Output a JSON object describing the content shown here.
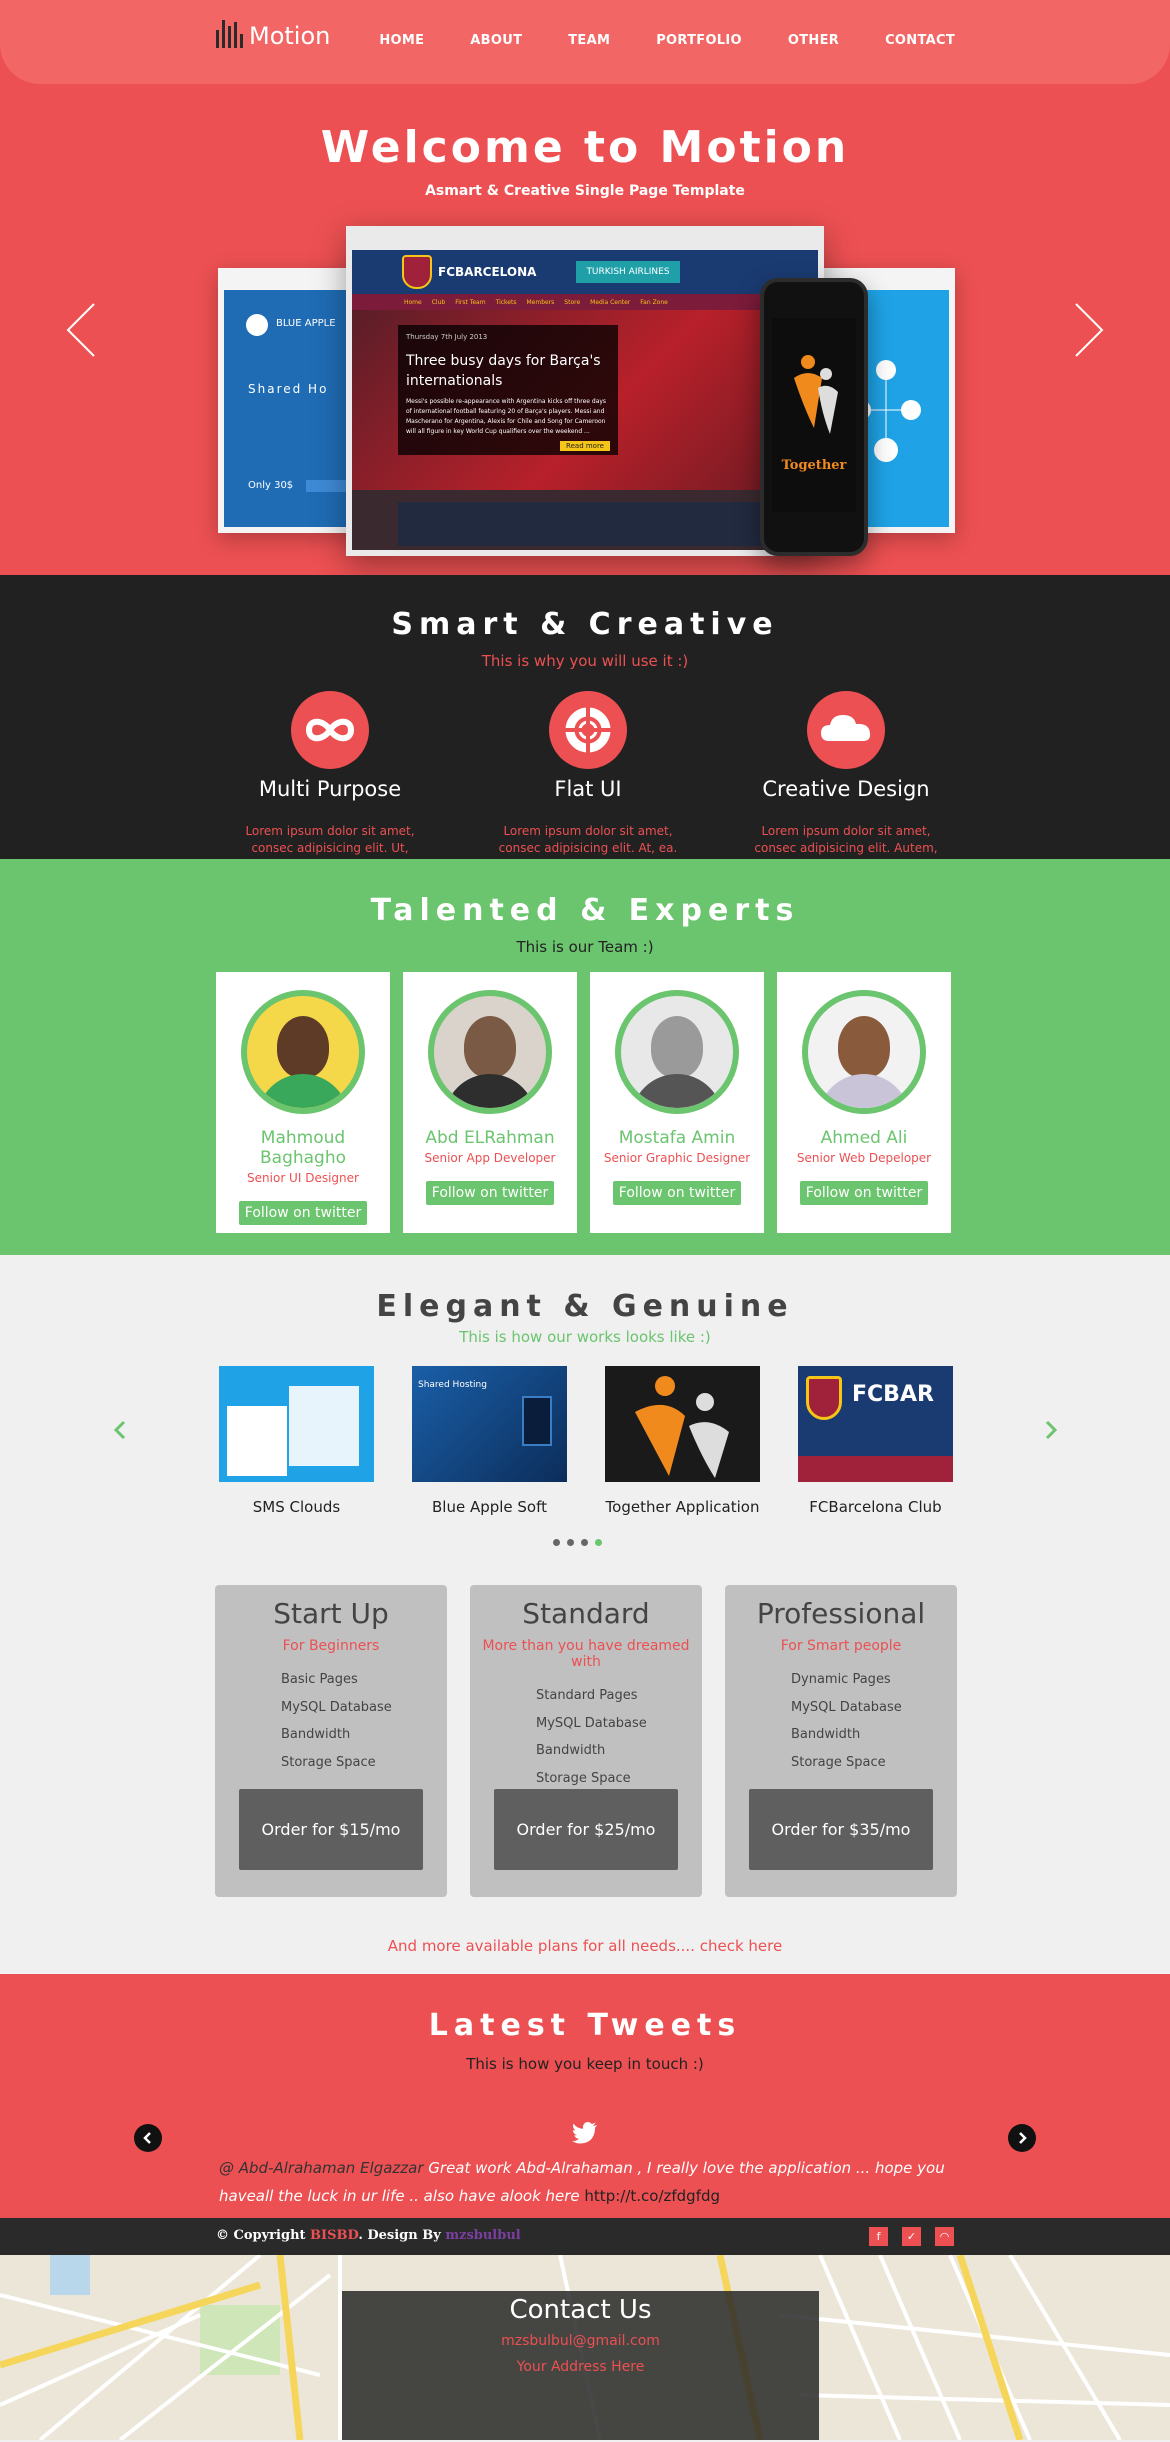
{
  "nav": {
    "logo": "Motion",
    "items": [
      "HOME",
      "ABOUT",
      "TEAM",
      "PORTFOLIO",
      "OTHER",
      "CONTACT"
    ]
  },
  "hero": {
    "title": "Welcome to Motion",
    "subtitle": "Asmart & Creative Single Page Template",
    "mock_left_brand": "BLUE APPLE",
    "mock_left_heading": "Shared Ho",
    "mock_left_price": "Only 30$",
    "mock_main_brand": "FCBARCELONA",
    "mock_main_airline": "TURKISH AIRLINES",
    "mock_main_menu": [
      "Home",
      "Club",
      "First Team",
      "Tickets",
      "Members",
      "Store",
      "Media Center",
      "Fan Zone"
    ],
    "mock_main_date": "Thursday 7th July 2013",
    "mock_main_headline": "Three busy days for Barça's internationals",
    "mock_main_body": "Messi's possible re-appearance with Argentina kicks off three days of international football featuring 20 of Barça's players. Messi and Mascherano for Argentina, Alexis for Chile and Song for Cameroon will all figure in key World Cup qualifiers over the weekend ...",
    "mock_main_readmore": "Read more",
    "phone_text": "Together"
  },
  "smart": {
    "title": "Smart & Creative",
    "subtitle": "This is why you will use it :)",
    "features": [
      {
        "title": "Multi Purpose",
        "icon": "infinity-icon",
        "text": "Lorem ipsum dolor sit amet, consec adipisicing elit. Ut, repudiandae"
      },
      {
        "title": "Flat UI",
        "icon": "lifebuoy-icon",
        "text": "Lorem ipsum dolor sit amet, consec adipisicing elit. At, ea. Lorem ipsum."
      },
      {
        "title": "Creative Design",
        "icon": "cloud-icon",
        "text": "Lorem ipsum dolor sit amet, consec adipisicing elit. Autem, Lorem ipsum."
      }
    ]
  },
  "team": {
    "title": "Talented & Experts",
    "subtitle": "This is our Team :)",
    "members": [
      {
        "name": "Mahmoud Baghagho",
        "role": "Senior UI Designer",
        "button": "Follow on twitter"
      },
      {
        "name": "Abd ELRahman",
        "role": "Senior App Developer",
        "button": "Follow on twitter"
      },
      {
        "name": "Mostafa Amin",
        "role": "Senior Graphic Designer",
        "button": "Follow on twitter"
      },
      {
        "name": "Ahmed Ali",
        "role": "Senior Web Depeloper",
        "button": "Follow on twitter"
      }
    ]
  },
  "works": {
    "title": "Elegant & Genuine",
    "subtitle": "This is how our works looks like :)",
    "projects": [
      "SMS Clouds",
      "Blue Apple Soft",
      "Together Application",
      "FCBarcelona Club"
    ],
    "project_thumb_texts": [
      "",
      "Shared Hosting",
      "",
      "FCBAR"
    ],
    "pagination_active": 4,
    "pagination_total": 4
  },
  "plans": [
    {
      "name": "Start Up",
      "tag": "For Beginners",
      "features": [
        "Basic Pages",
        "MySQL Database",
        "Bandwidth",
        "Storage Space"
      ],
      "button": "Order for $15/mo"
    },
    {
      "name": "Standard",
      "tag": "More than you have dreamed with",
      "features": [
        "Standard Pages",
        "MySQL Database",
        "Bandwidth",
        "Storage Space"
      ],
      "button": "Order for $25/mo"
    },
    {
      "name": "Professional",
      "tag": "For Smart people",
      "features": [
        "Dynamic Pages",
        "MySQL Database",
        "Bandwidth",
        "Storage Space"
      ],
      "button": "Order for $35/mo"
    }
  ],
  "more_plans": "And more available plans for all needs.... check here",
  "tweets": {
    "title": "Latest Tweets",
    "subtitle": "This is how you keep in touch :)",
    "author": "@ Abd-Alrahaman Elgazzar",
    "text": " Great work Abd-Alrahaman , I really love the application  ... hope you haveall the luck in ur life ..  also have alook here ",
    "link": "http://t.co/zfdgfdg"
  },
  "footer": {
    "copy_prefix": "© Copyright ",
    "brand": "BISBD",
    "design_by": ". Design By ",
    "designer": "mzsbulbul",
    "socials": [
      "facebook-icon",
      "twitter-icon",
      "rss-icon"
    ]
  },
  "contact": {
    "title": "Contact Us",
    "email": "mzsbulbul@gmail.com",
    "address": "Your Address Here"
  },
  "colors": {
    "red": "#ec5052",
    "green": "#6bc46e",
    "dark": "#212121"
  }
}
